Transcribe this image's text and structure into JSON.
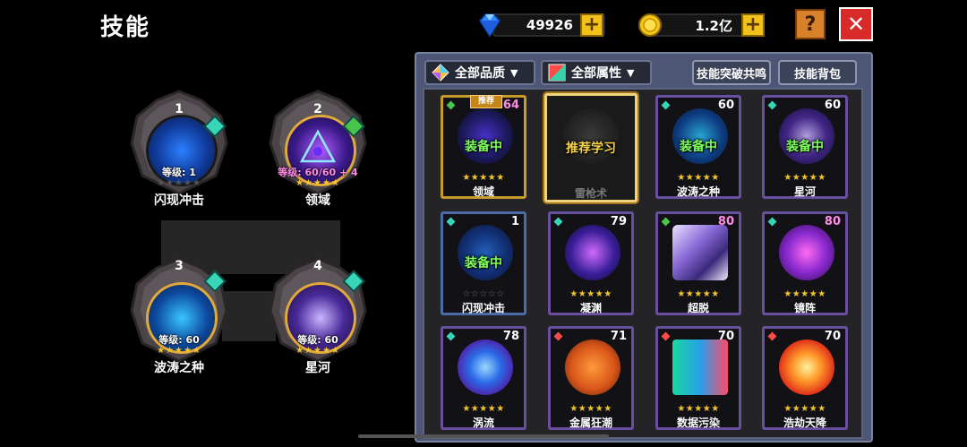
{
  "header": {
    "title": "技能",
    "gems": "49926",
    "gold": "1.2亿",
    "help_label": "?",
    "close_label": "✕"
  },
  "colors": {
    "accent_gold": "#f2c21b",
    "close_red": "#d92a2a",
    "equip_green": "#7dff5a",
    "panel_bg": "#4d5674"
  },
  "slots": [
    {
      "num": "1",
      "level": "等级: 1",
      "stars": "★★★★★",
      "name": "闪现冲击",
      "icon": "flash-strike-icon"
    },
    {
      "num": "2",
      "level": "等级: 60/60 + 4",
      "stars": "★★★★★",
      "name": "领域",
      "icon": "domain-icon"
    },
    {
      "num": "3",
      "level": "等级: 60",
      "stars": "★★★★★",
      "name": "波涛之种",
      "icon": "wave-seed-icon"
    },
    {
      "num": "4",
      "level": "等级: 60",
      "stars": "★★★★★",
      "name": "星河",
      "icon": "galaxy-icon"
    }
  ],
  "panel": {
    "filter_quality": "全部品质",
    "filter_attr": "全部属性",
    "btn_resonance": "技能突破共鸣",
    "btn_bag": "技能背包"
  },
  "cards": [
    {
      "name": "领域",
      "level": "64",
      "status": "装备中",
      "badge": "推荐",
      "stars": "★★★★★"
    },
    {
      "name": "雷枪术",
      "level": "",
      "status": "推荐学习",
      "badge": "",
      "stars": ""
    },
    {
      "name": "波涛之种",
      "level": "60",
      "status": "装备中",
      "badge": "",
      "stars": "★★★★★"
    },
    {
      "name": "星河",
      "level": "60",
      "status": "装备中",
      "badge": "",
      "stars": "★★★★★"
    },
    {
      "name": "闪现冲击",
      "level": "1",
      "status": "装备中",
      "badge": "",
      "stars": "☆☆☆☆☆"
    },
    {
      "name": "凝渊",
      "level": "79",
      "status": "",
      "badge": "",
      "stars": "★★★★★"
    },
    {
      "name": "超脱",
      "level": "80",
      "status": "",
      "badge": "",
      "stars": "★★★★★"
    },
    {
      "name": "镜阵",
      "level": "80",
      "status": "",
      "badge": "",
      "stars": "★★★★★"
    },
    {
      "name": "涡流",
      "level": "78",
      "status": "",
      "badge": "",
      "stars": "★★★★★"
    },
    {
      "name": "金属狂潮",
      "level": "71",
      "status": "",
      "badge": "",
      "stars": "★★★★★"
    },
    {
      "name": "数据污染",
      "level": "70",
      "status": "",
      "badge": "",
      "stars": "★★★★★"
    },
    {
      "name": "浩劫天降",
      "level": "70",
      "status": "",
      "badge": "",
      "stars": "★★★★★"
    }
  ]
}
